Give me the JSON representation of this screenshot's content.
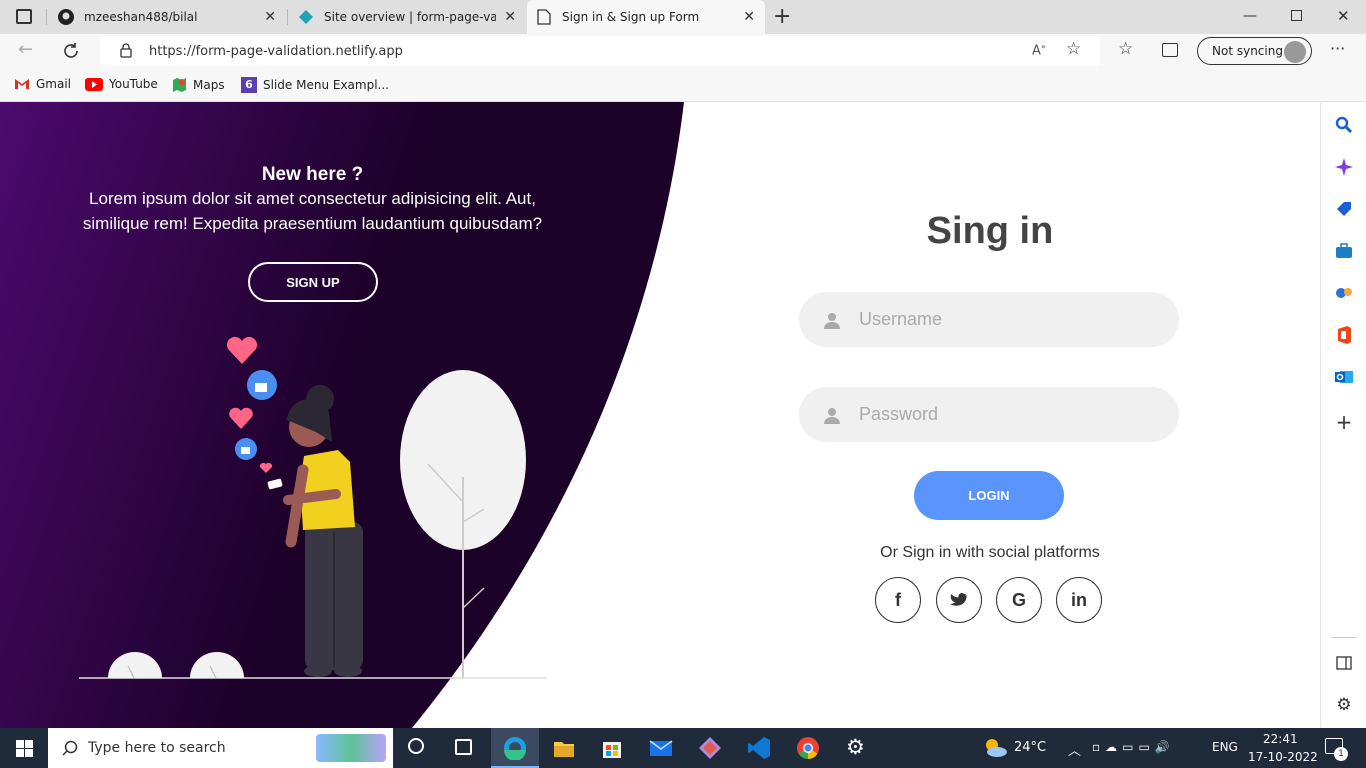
{
  "browser": {
    "tabs": [
      {
        "title": "mzeeshan488/bilal",
        "icon": "github-icon"
      },
      {
        "title": "Site overview | form-page-valida",
        "icon": "netlify-icon"
      },
      {
        "title": "Sign in & Sign up Form",
        "icon": "page-icon",
        "active": true
      }
    ],
    "url": "https://form-page-validation.netlify.app",
    "profile_label": "Not syncing",
    "favorites": [
      {
        "label": "Gmail",
        "icon": "gmail-icon"
      },
      {
        "label": "YouTube",
        "icon": "youtube-icon"
      },
      {
        "label": "Maps",
        "icon": "maps-icon"
      },
      {
        "label": "Slide Menu Exampl...",
        "icon": "bookmark-6-icon"
      }
    ]
  },
  "left_panel": {
    "heading": "New here ?",
    "text": "Lorem ipsum dolor sit amet consectetur adipisicing elit. Aut, similique rem! Expedita praesentium laudantium quibusdam?",
    "button": "SIGN UP",
    "colors": {
      "dark": "#1c0128",
      "purple": "#4c0a6e"
    }
  },
  "form": {
    "title": "Sing in",
    "username_placeholder": "Username",
    "password_placeholder": "Password",
    "login_button": "LOGIN",
    "social_text": "Or Sign in with social platforms",
    "social": [
      {
        "label": "f",
        "icon": "facebook-icon"
      },
      {
        "label": "t",
        "icon": "twitter-icon"
      },
      {
        "label": "G",
        "icon": "google-icon"
      },
      {
        "label": "in",
        "icon": "linkedin-icon"
      }
    ],
    "accent": "#5995fd"
  },
  "taskbar": {
    "search_placeholder": "Type here to search",
    "weather": "24°C",
    "language": "ENG",
    "time": "22:41",
    "date": "17-10-2022",
    "notification_count": "1"
  }
}
